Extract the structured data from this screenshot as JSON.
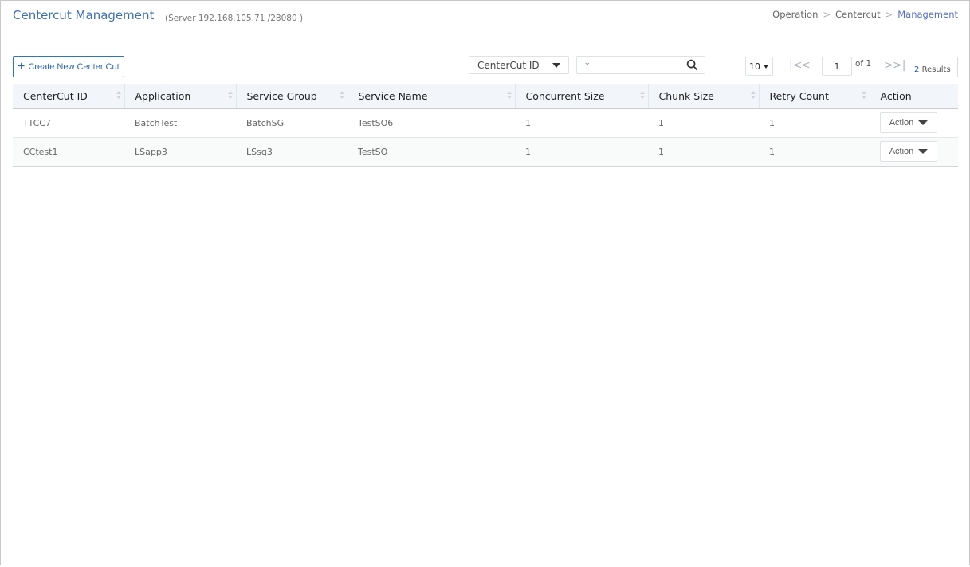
{
  "header": {
    "title": "Centercut Management",
    "server_info": "(Server 192.168.105.71 /28080 )",
    "breadcrumb": [
      "Operation",
      "Centercut",
      "Management"
    ],
    "breadcrumb_separator": ">"
  },
  "toolbar": {
    "create_label": "Create New Center Cut",
    "filter_field": "CenterCut ID",
    "search_value": "*",
    "page_size": "10",
    "current_page": "1",
    "of_total": "of 1",
    "results_count": "2",
    "results_label": "Results",
    "first_icon": "|<",
    "prev_icon": "<",
    "next_icon": ">",
    "last_icon": ">|"
  },
  "table": {
    "columns": [
      "CenterCut ID",
      "Application",
      "Service Group",
      "Service Name",
      "Concurrent Size",
      "Chunk Size",
      "Retry Count",
      "Action"
    ],
    "rows": [
      {
        "id": "TTCC7",
        "application": "BatchTest",
        "service_group": "BatchSG",
        "service_name": "TestSO6",
        "concurrent_size": "1",
        "chunk_size": "1",
        "retry_count": "1",
        "action": "Action"
      },
      {
        "id": "CCtest1",
        "application": "LSapp3",
        "service_group": "LSsg3",
        "service_name": "TestSO",
        "concurrent_size": "1",
        "chunk_size": "1",
        "retry_count": "1",
        "action": "Action"
      }
    ]
  },
  "colors": {
    "title": "#3e6fb0",
    "accent_border": "#2b78b8",
    "header_bg": "#f2f5fa"
  }
}
